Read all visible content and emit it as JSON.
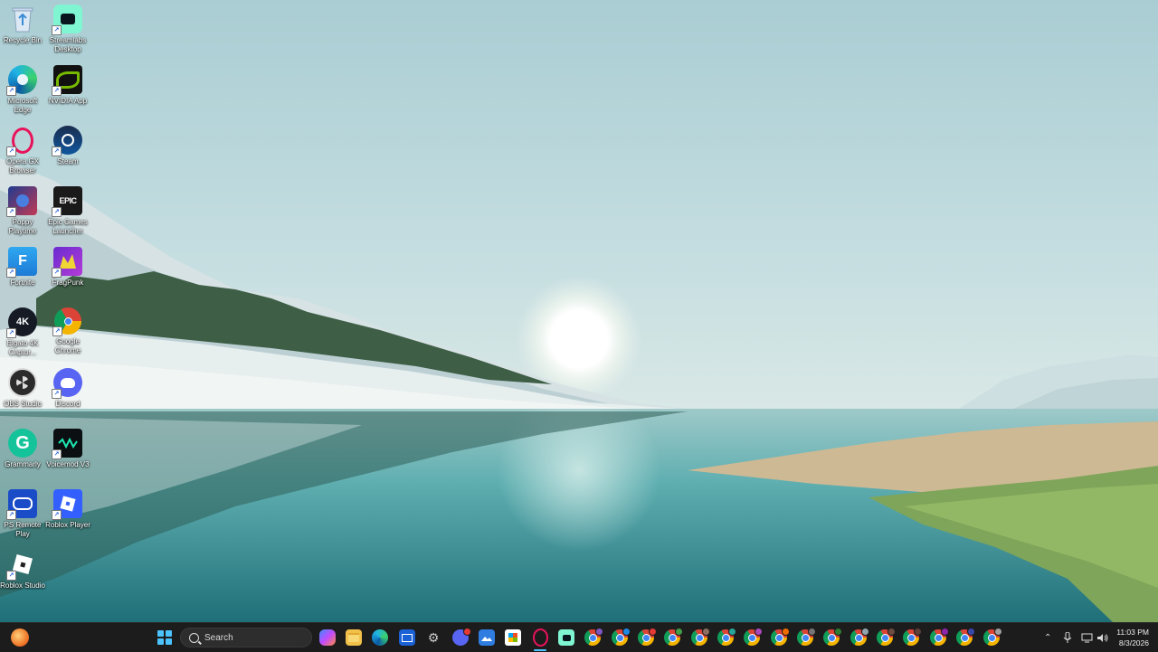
{
  "desktop": {
    "icons": [
      {
        "label": "Recycle Bin",
        "icon": "recycle-bin-icon"
      },
      {
        "label": "Streamlabs Desktop",
        "icon": "streamlabs-icon"
      },
      {
        "label": "Microsoft Edge",
        "icon": "edge-icon"
      },
      {
        "label": "NVIDIA App",
        "icon": "nvidia-icon"
      },
      {
        "label": "Opera GX Browser",
        "icon": "opera-gx-icon"
      },
      {
        "label": "Steam",
        "icon": "steam-icon"
      },
      {
        "label": "Poppy Playtime",
        "icon": "poppy-playtime-icon"
      },
      {
        "label": "Epic Games Launcher",
        "icon": "epic-games-icon",
        "glyph": "EPIC"
      },
      {
        "label": "Fortnite",
        "icon": "fortnite-icon",
        "glyph": "F"
      },
      {
        "label": "FragPunk",
        "icon": "fragpunk-icon"
      },
      {
        "label": "Elgato 4K Captur...",
        "icon": "elgato-4k-icon",
        "glyph": "4K"
      },
      {
        "label": "Google Chrome",
        "icon": "chrome-icon"
      },
      {
        "label": "OBS Studio",
        "icon": "obs-icon"
      },
      {
        "label": "Discord",
        "icon": "discord-icon"
      },
      {
        "label": "Grammarly",
        "icon": "grammarly-icon",
        "glyph": "G"
      },
      {
        "label": "Voicemod V3",
        "icon": "voicemod-icon"
      },
      {
        "label": "PS Remote Play",
        "icon": "ps-remote-play-icon"
      },
      {
        "label": "Roblox Player",
        "icon": "roblox-player-icon"
      },
      {
        "label": "Roblox Studio",
        "icon": "roblox-studio-icon"
      }
    ]
  },
  "taskbar": {
    "search_placeholder": "Search",
    "clock_time": "11:03 PM",
    "clock_date": "8/3/2026",
    "colors": {
      "background": "#1c1c1c",
      "accent": "#4cc2ff"
    }
  }
}
